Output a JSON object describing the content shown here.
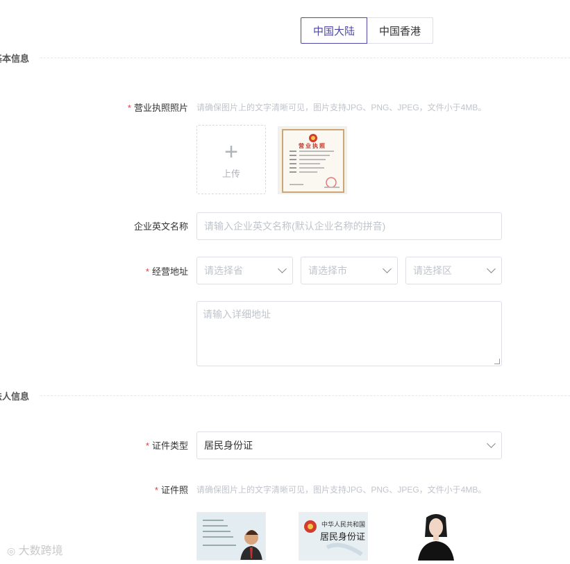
{
  "tabs": [
    {
      "label": "中国大陆",
      "active": true
    },
    {
      "label": "中国香港",
      "active": false
    }
  ],
  "sections": {
    "basic_info": "基本信息",
    "legal_rep_info": "法人信息"
  },
  "form": {
    "business_license": {
      "label": "营业执照照片",
      "required": true,
      "hint": "请确保图片上的文字清晰可见，图片支持JPG、PNG、JPEG，文件小于4MB。",
      "upload_text": "上传",
      "upload_icon": "plus-icon",
      "license_title": "营业执照"
    },
    "english_name": {
      "label": "企业英文名称",
      "placeholder": "请输入企业英文名称(默认企业名称的拼音)"
    },
    "address": {
      "label": "经营地址",
      "required": true,
      "province_placeholder": "请选择省",
      "city_placeholder": "请选择市",
      "district_placeholder": "请选择区",
      "detail_placeholder": "请输入详细地址"
    },
    "id_type": {
      "label": "证件类型",
      "required": true,
      "value": "居民身份证"
    },
    "id_photo": {
      "label": "证件照",
      "required": true,
      "hint": "请确保图片上的文字清晰可见，图片支持JPG、PNG、JPEG，文件小于4MB。",
      "id_back_line1": "中华人民共和国",
      "id_back_line2": "居民身份证"
    }
  },
  "watermark": "大数跨境",
  "colors": {
    "accent": "#4f46a8",
    "required": "#e4393c",
    "placeholder": "#c0c4cc",
    "border": "#dcdfe6"
  }
}
